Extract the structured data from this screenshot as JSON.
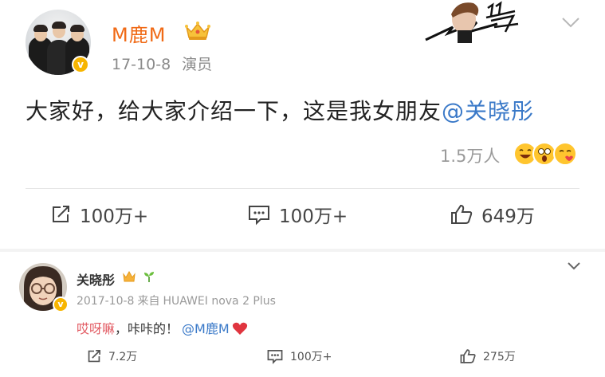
{
  "post": {
    "username": "M鹿M",
    "date": "17-10-8",
    "source": "演员",
    "text": "大家好，给大家介绍一下，这是我女朋友",
    "mention": "@关晓彤",
    "reads": "1.5万人",
    "verified_symbol": "v",
    "icons": [
      "crown-icon",
      "chevron-down-icon",
      "repost-icon",
      "comment-icon",
      "like-icon"
    ],
    "colors": {
      "username": "#f06a16",
      "link": "#3a79c8",
      "verified": "#f7b500"
    }
  },
  "actions": {
    "repost": "100万+",
    "comment": "100万+",
    "like": "649万"
  },
  "comment": {
    "username": "关晓彤",
    "date": "2017-10-8",
    "source_prefix": "来自",
    "device": "HUAWEI nova 2 Plus",
    "text_highlight": "哎呀嘛",
    "text_rest": "，咔咔的！",
    "mention": "@M鹿M",
    "verified_symbol": "v",
    "icons": [
      "crown-badge-icon",
      "sprout-icon",
      "heart-icon",
      "chevron-down-icon"
    ],
    "actions": {
      "repost": "7.2万",
      "comment": "100万+",
      "like": "275万"
    }
  }
}
